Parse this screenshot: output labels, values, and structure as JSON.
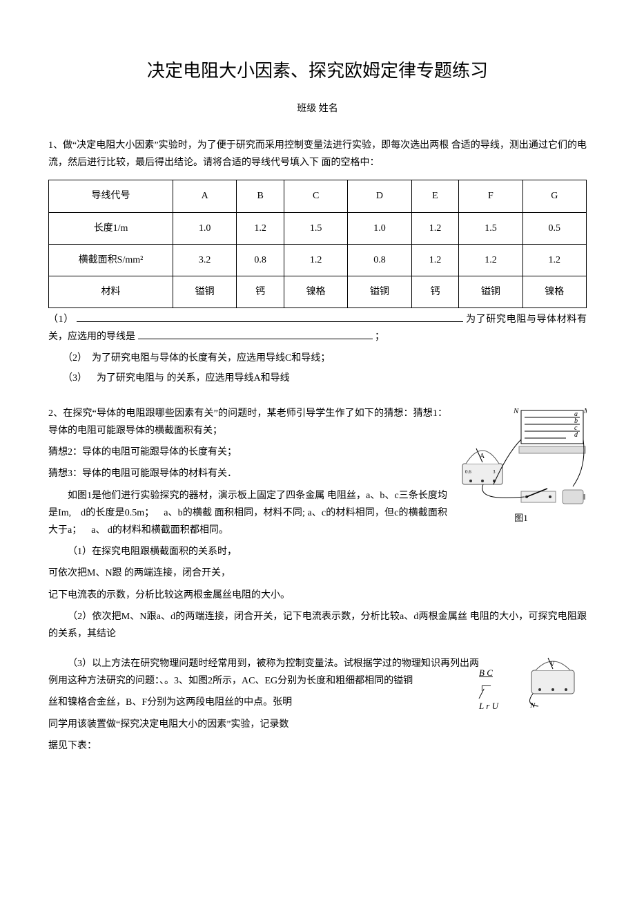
{
  "title": "决定电阻大小因素、探究欧姆定律专题练习",
  "header_fields": "班级  姓名",
  "q1": {
    "prompt": "1、做“决定电阻大小因素”实验时，为了便于研究而采用控制变量法进行实验，即每次选出两根 合适的导线，测出通过它们的电流，然后进行比较，最后得出结论。请将合适的导线代号填入下 面的空格中：",
    "table": {
      "rows": [
        [
          "导线代号",
          "A",
          "B",
          "C",
          "D",
          "E",
          "F",
          "G"
        ],
        [
          "长度1/m",
          "1.0",
          "1.2",
          "1.5",
          "1.0",
          "1.2",
          "1.5",
          "0.5"
        ],
        [
          "横截面积S/mm²",
          "3.2",
          "0.8",
          "1.2",
          "0.8",
          "1.2",
          "1.2",
          "1.2"
        ],
        [
          "材料",
          "镒铜",
          "钙",
          "镍格",
          "镒铜",
          "钙",
          "镒铜",
          "镍格"
        ]
      ]
    },
    "item1_pre": "（1）",
    "item1_mid": "为了研究电阻与导体材料有关，应选用的导线是 ",
    "item1_end": "；",
    "item2": "（2）　为了研究电阻与导体的长度有关，应选用导线C和导线；",
    "item3": "（3） 为了研究电阻与 的关系，应选用导线A和导线"
  },
  "q2": {
    "prompt": "2、在探究“导体的电阻跟哪些因素有关”的问题时，某老师引导学生作了如下的猜想：猜想1：导体的电阻可能跟导体的横截面积有关；",
    "guess2": "猜想2：导体的电阻可能跟导体的长度有关；",
    "guess3": "猜想3：导体的电阻可能跟导体的材料有关．",
    "body": "如图1是他们进行实验探究的器材，演示板上固定了四条金属 电阻丝，a、b、c三条长度均是Im, d的长度是0.5m； a、b的横截 面积相同，材料不同; a、c的材料相同，但c的横截面积大于a； a、 d的材料和横截面积都相同。",
    "item1a": "（1）在探究电阻跟横截面积的关系时，",
    "item1b": "可依次把M、N跟 的两端连接，闭合开关，",
    "item1c": "记下电流表的示数，分析比较这两根金属丝电阻的大小。",
    "item2": "（2）依次把M、N跟a、d的两端连接，闭合开关，记下电流表示数，分析比较a、d两根金属丝 电阻的大小，可探究电阻跟 的关系，其结论",
    "item3": "（3）以上方法在研究物理问题时经常用到，被称为控制变量法。试根据学过的物理知识再列出两 例用这种方法研究的问题：、。3、如图2所示，AC、EG分别为长度和粗细都相同的镒铜",
    "item3b": "丝和镍格合金丝，B、F分别为这两段电阻丝的中点。张明",
    "item3c": "同学用该装置做“探究决定电阻大小的因素”实验，记录数",
    "item3d": "据见下表：",
    "fig1_caption": "图1",
    "fig1_labels": {
      "N": "N",
      "M": "M",
      "a": "a",
      "b": "b",
      "c": "c",
      "d": "d"
    },
    "fig2_labels": {
      "BC": "B C",
      "LrU": "L r U",
      "N": "N"
    }
  }
}
